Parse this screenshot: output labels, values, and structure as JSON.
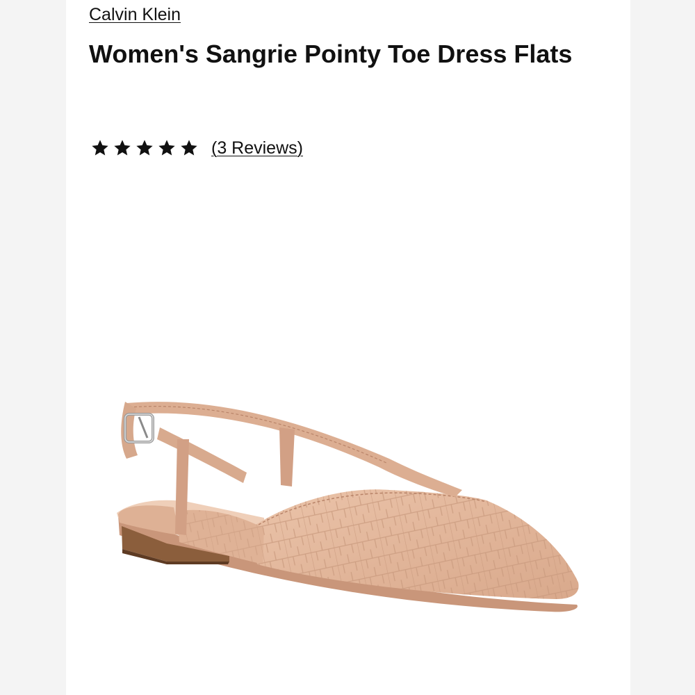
{
  "product": {
    "brand": "Calvin Klein",
    "title": "Women's Sangrie Pointy Toe Dress Flats",
    "rating": {
      "stars": 5,
      "max_stars": 5,
      "reviews_label": "(3 Reviews)"
    },
    "image": {
      "alt": "Women's Sangrie Pointy Toe Dress Flats",
      "description_icon": "slingback-flat-shoe",
      "color": "#e2b79c"
    }
  },
  "colors": {
    "background": "#ffffff",
    "side_background": "#f4f4f4",
    "text": "#111111",
    "shoe_base": "#e2b79c",
    "shoe_dark": "#c9967a",
    "heel": "#8b5e3c"
  }
}
